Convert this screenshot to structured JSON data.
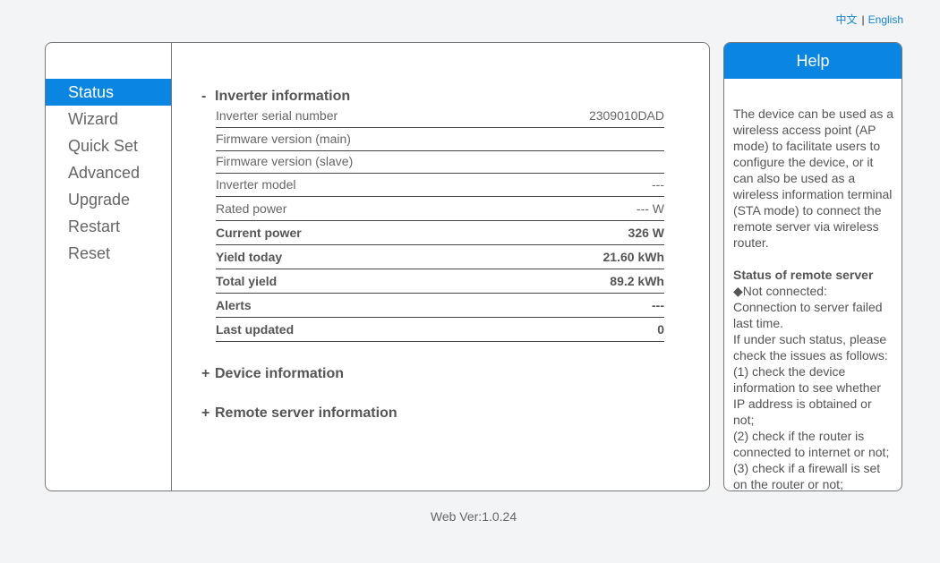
{
  "lang": {
    "chinese": "中文",
    "separator": "|",
    "english": "English"
  },
  "nav": {
    "items": [
      {
        "label": "Status"
      },
      {
        "label": "Wizard"
      },
      {
        "label": "Quick Set"
      },
      {
        "label": "Advanced"
      },
      {
        "label": "Upgrade"
      },
      {
        "label": "Restart"
      },
      {
        "label": "Reset"
      }
    ],
    "active": "Status"
  },
  "inverter": {
    "toggle": "-",
    "title": "Inverter information",
    "rows": [
      {
        "label": "Inverter serial number",
        "value": "2309010DAD"
      },
      {
        "label": "Firmware version (main)",
        "value": ""
      },
      {
        "label": "Firmware version (slave)",
        "value": ""
      },
      {
        "label": "Inverter model",
        "value": "---"
      },
      {
        "label": "Rated power",
        "value": "--- W"
      },
      {
        "label": "Current power",
        "value": "326 W"
      },
      {
        "label": "Yield today",
        "value": "21.60 kWh"
      },
      {
        "label": "Total yield",
        "value": "89.2 kWh"
      },
      {
        "label": "Alerts",
        "value": "---"
      },
      {
        "label": "Last updated",
        "value": "0"
      }
    ]
  },
  "device": {
    "toggle": "+",
    "title": "Device information"
  },
  "remote": {
    "toggle": "+",
    "title": "Remote server information"
  },
  "help": {
    "title": "Help",
    "intro": "The device can be used as a wireless access point (AP mode) to facilitate users to configure the device, or it can also be used as a wireless information terminal (STA mode) to connect the remote server via wireless router.",
    "status_heading": "Status of remote server",
    "not_connected": "◆Not connected:",
    "line1": "Connection to server failed last time.",
    "line2": "If under such status, please check the issues as follows:",
    "check1": "(1) check the device information to see whether IP address is obtained or not;",
    "check2": "(2) check if the router is connected to internet or not;",
    "check3": "(3) check if a firewall is set on the router or not;"
  },
  "footer": {
    "version": "Web Ver:1.0.24"
  }
}
